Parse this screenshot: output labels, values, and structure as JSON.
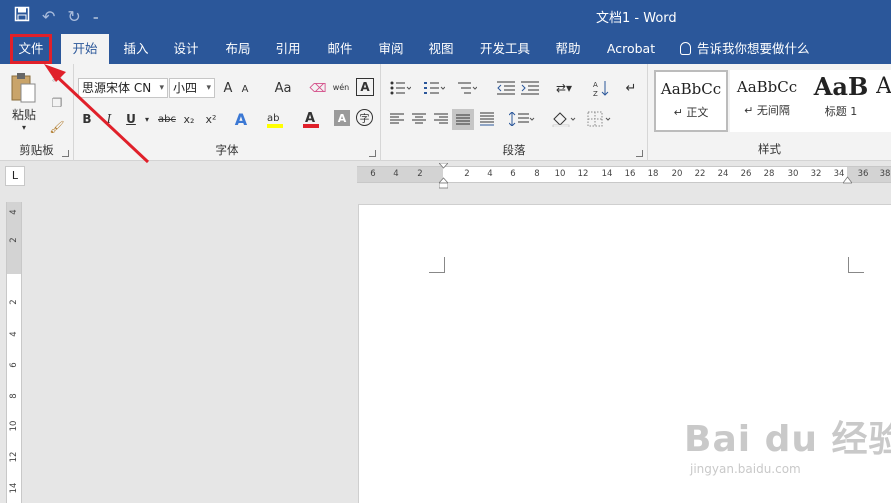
{
  "title_bar": {
    "doc_title": "文档1  -  Word",
    "qat": {
      "save_icon": "save-icon",
      "undo_icon": "undo-icon",
      "redo_icon": "redo-icon",
      "customize_icon": "customize-qat-icon"
    }
  },
  "tabs": [
    {
      "label": "文件"
    },
    {
      "label": "开始"
    },
    {
      "label": "插入"
    },
    {
      "label": "设计"
    },
    {
      "label": "布局"
    },
    {
      "label": "引用"
    },
    {
      "label": "邮件"
    },
    {
      "label": "审阅"
    },
    {
      "label": "视图"
    },
    {
      "label": "开发工具"
    },
    {
      "label": "帮助"
    },
    {
      "label": "Acrobat"
    }
  ],
  "tell_me": "告诉我你想要做什么",
  "ribbon": {
    "clipboard": {
      "label": "剪贴板",
      "paste": "粘贴"
    },
    "font": {
      "label": "字体",
      "font_name": "思源宋体 CN",
      "font_size": "小四",
      "grow": "A",
      "shrink": "A",
      "change_case": "Aa",
      "phonetic": "wén",
      "bold": "B",
      "italic": "I",
      "underline": "U",
      "strike": "abc",
      "sub": "x₂",
      "sup": "x²"
    },
    "paragraph": {
      "label": "段落"
    },
    "styles": {
      "label": "样式",
      "items": [
        {
          "sample": "AaBbCc",
          "name": "↵ 正文"
        },
        {
          "sample": "AaBbCc",
          "name": "↵ 无间隔"
        },
        {
          "sample": "AaB",
          "name": "标题 1"
        },
        {
          "sample": "A",
          "name": ""
        }
      ]
    }
  },
  "ruler": {
    "corner": "L",
    "h_ticks": [
      "6",
      "4",
      "2",
      "2",
      "4",
      "6",
      "8",
      "10",
      "12",
      "14",
      "16",
      "18",
      "20",
      "22",
      "24",
      "26",
      "28",
      "30",
      "32",
      "34",
      "36",
      "38"
    ],
    "v_ticks": [
      "4",
      "2",
      "2",
      "4",
      "6",
      "8",
      "10",
      "12",
      "14"
    ]
  },
  "colors": {
    "brand": "#2b579a",
    "annotation": "#e0202a",
    "highlight": "#ffff00",
    "font_color": "#e0202a"
  },
  "watermark": {
    "main": "Bai du 经验",
    "sub": "jingyan.baidu.com"
  }
}
